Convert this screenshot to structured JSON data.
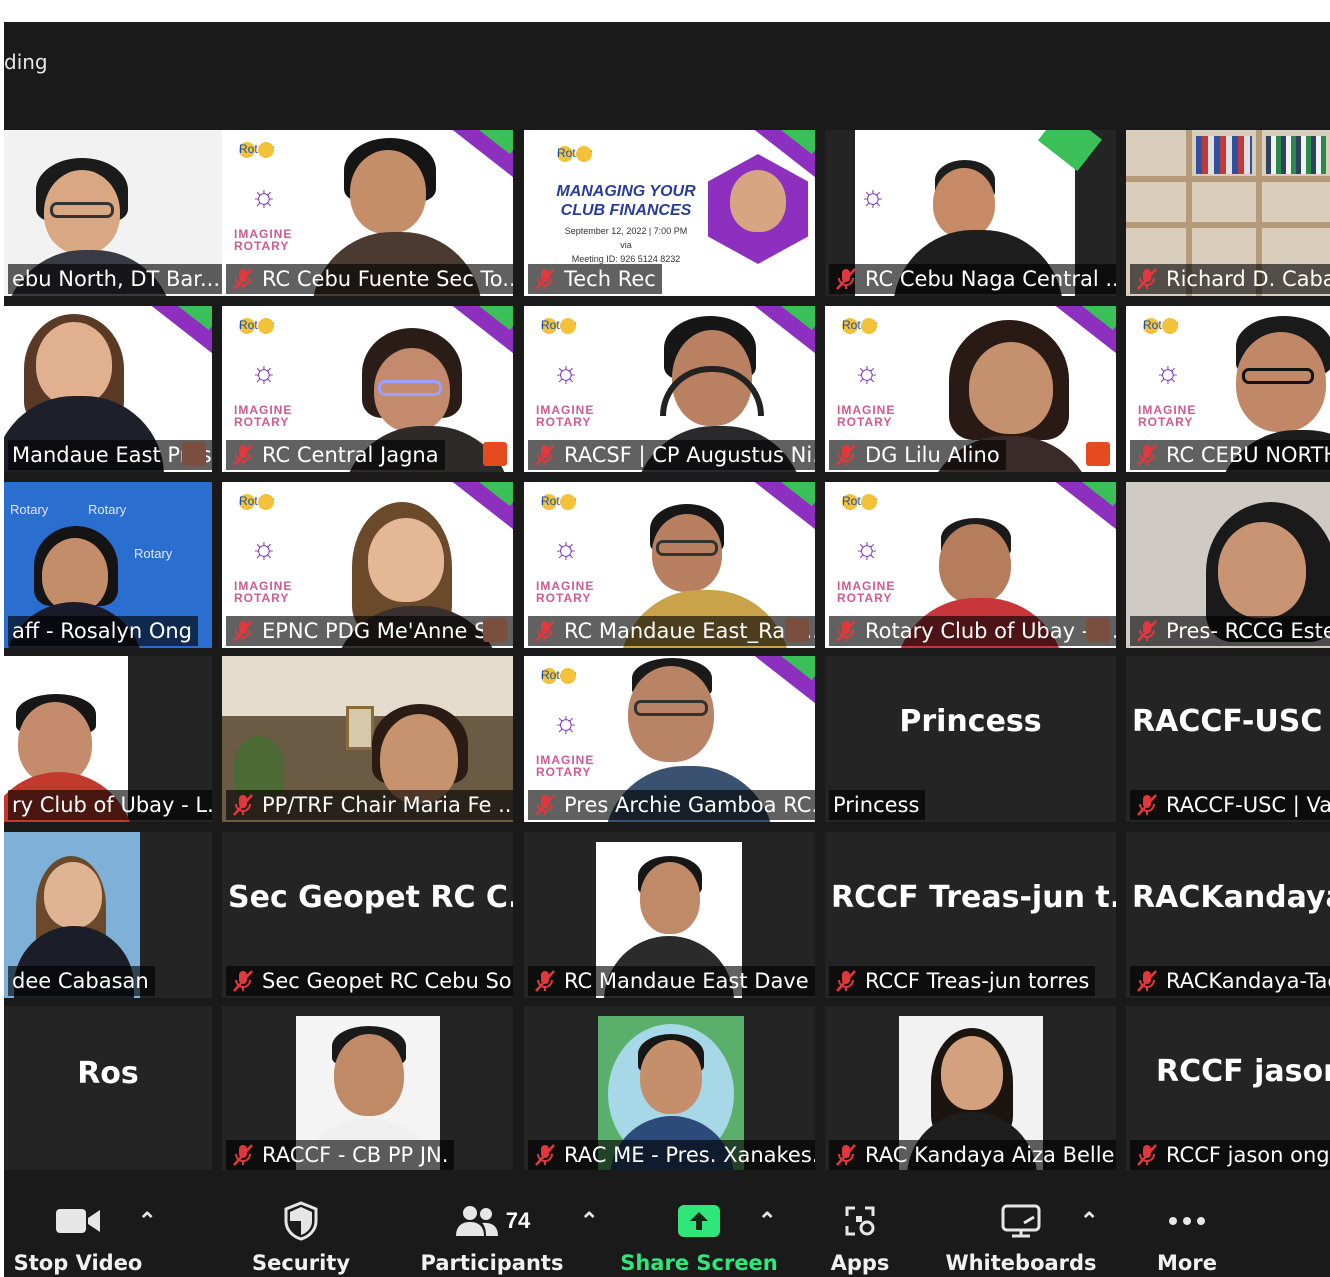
{
  "status_text": "ding",
  "tiles": [
    {
      "label": "ebu North, DT Bar..."
    },
    {
      "label": "RC Cebu Fuente Sec To..."
    },
    {
      "label": "Tech Rec"
    },
    {
      "label": "RC Cebu Naga Central ..."
    },
    {
      "label": "Richard D. Cabalu"
    },
    {
      "label": "Mandaue East Pres ..."
    },
    {
      "label": "RC Central Jagna"
    },
    {
      "label": "RACSF | CP Augustus Ni..."
    },
    {
      "label": "DG Lilu Alino"
    },
    {
      "label": "RC CEBU NORTH"
    },
    {
      "label": "aff - Rosalyn Ong"
    },
    {
      "label": "EPNC PDG Me'Anne S..."
    },
    {
      "label": "RC Mandaue East_Ram..."
    },
    {
      "label": "Rotary Club of Ubay - P..."
    },
    {
      "label": "Pres- RCCG Ester"
    },
    {
      "label": "ry Club of Ubay - L..."
    },
    {
      "label": "PP/TRF Chair Maria Fe ..."
    },
    {
      "label": "Pres Archie Gamboa RC..."
    },
    {
      "label": "Princess",
      "big": "Princess"
    },
    {
      "label": "RACCF-USC | Van",
      "big": "RACCF-USC |"
    },
    {
      "label": "dee Cabasan"
    },
    {
      "label": "Sec Geopet RC Cebu So...",
      "big": "Sec Geopet RC C..."
    },
    {
      "label": "RC Mandaue East Dave ..."
    },
    {
      "label": "RCCF Treas-jun torres",
      "big": "RCCF Treas-jun t..."
    },
    {
      "label": "RACKandaya-Tacl",
      "big": "RACKandaya"
    },
    {
      "big": "Ros"
    },
    {
      "label": "RACCF - CB PP JN."
    },
    {
      "label": "RAC ME - Pres. Xanakes..."
    },
    {
      "label": "RAC Kandaya Aiza Belle"
    },
    {
      "label": "RCCF jason ong",
      "big": "RCCF jason"
    }
  ],
  "banner": {
    "rotary": "Rotary",
    "imagine": "IMAGINE",
    "rotary_sub": "ROTARY",
    "title_line1": "MANAGING YOUR",
    "title_line2": "CLUB FINANCES",
    "date_line": "September 12, 2022 | 7:00 PM",
    "via": "via",
    "meeting_id": "Meeting ID: 926 5124 8232"
  },
  "toolbar": {
    "stop_video": "Stop Video",
    "security": "Security",
    "participants": "Participants",
    "participants_count": "74",
    "share_screen": "Share Screen",
    "apps": "Apps",
    "whiteboards": "Whiteboards",
    "more": "More"
  },
  "colors": {
    "background": "#1a1a1a",
    "tile": "#242424",
    "active_speaker": "#e8e44f",
    "share_green": "#2fe67a",
    "mute_red": "#e0383c",
    "rotary_purple": "#8d2fbf",
    "rotary_green": "#3bbf58"
  }
}
